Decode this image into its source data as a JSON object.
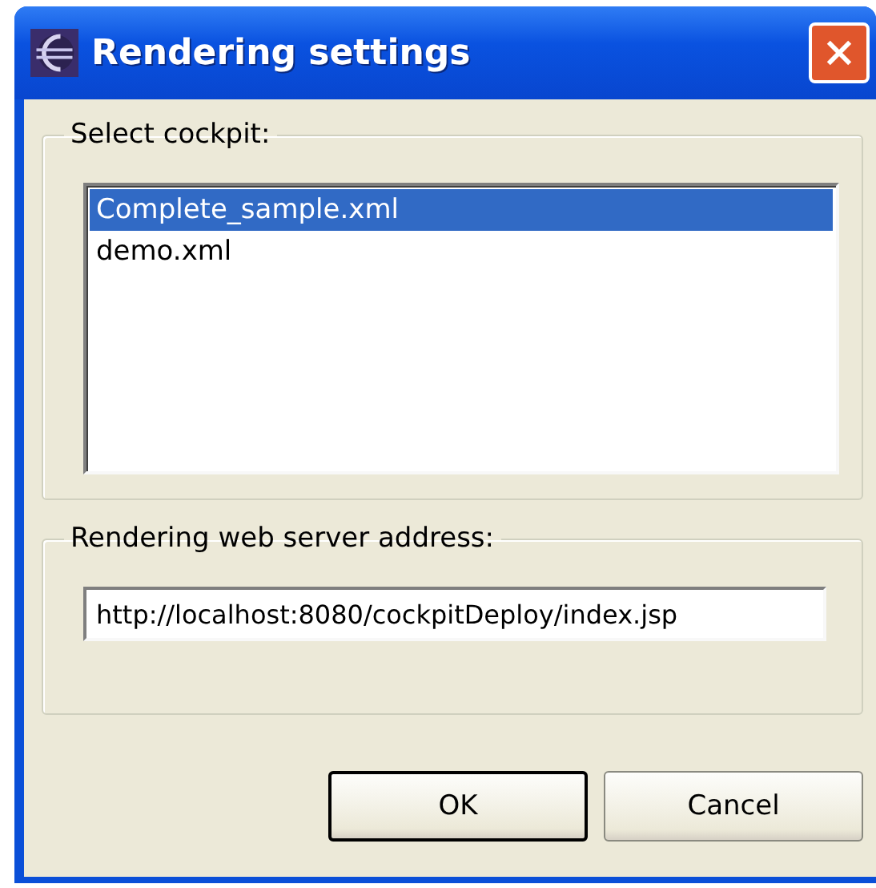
{
  "window": {
    "title": "Rendering settings"
  },
  "cockpit_group": {
    "label": "Select cockpit:",
    "items": [
      {
        "label": "Complete_sample.xml",
        "selected": true
      },
      {
        "label": "demo.xml",
        "selected": false
      }
    ]
  },
  "server_group": {
    "label": "Rendering web server address:",
    "value": "http://localhost:8080/cockpitDeploy/index.jsp"
  },
  "buttons": [
    {
      "label": "OK",
      "default": true
    },
    {
      "label": "Cancel",
      "default": false
    }
  ]
}
